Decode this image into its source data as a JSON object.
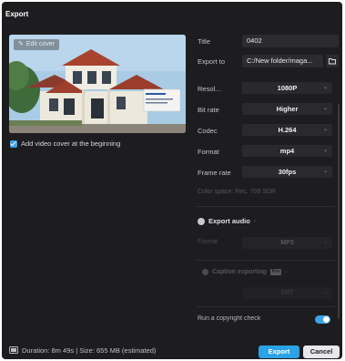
{
  "window": {
    "title": "Export"
  },
  "preview": {
    "edit_cover_label": "Edit cover"
  },
  "cover": {
    "checked": true,
    "label": "Add video cover at the beginning"
  },
  "settings": {
    "title": {
      "label": "Title",
      "value": "0402"
    },
    "export_to": {
      "label": "Export to",
      "value": "C:/New folder/maga..."
    },
    "resolution": {
      "label": "Resol...",
      "value": "1080P"
    },
    "bit_rate": {
      "label": "Bit rate",
      "value": "Higher"
    },
    "codec": {
      "label": "Codec",
      "value": "H.264"
    },
    "format": {
      "label": "Format",
      "value": "mp4"
    },
    "frame_rate": {
      "label": "Frame rate",
      "value": "30fps"
    },
    "color_space": "Color space: Rec. 709 SDR"
  },
  "audio": {
    "label": "Export audio",
    "format_label": "Format",
    "format_value": "MP3"
  },
  "captions": {
    "label": "Caption exporting",
    "badge": "Pro",
    "value": "SRT"
  },
  "copyright": {
    "label": "Run a copyright check",
    "enabled": true
  },
  "footer": {
    "info": "Duration: 8m 49s | Size: 655 MB (estimated)",
    "export_label": "Export",
    "cancel_label": "Cancel"
  },
  "colors": {
    "accent": "#2ba3e6",
    "background": "#1d1d20",
    "field": "#2c2c30"
  }
}
